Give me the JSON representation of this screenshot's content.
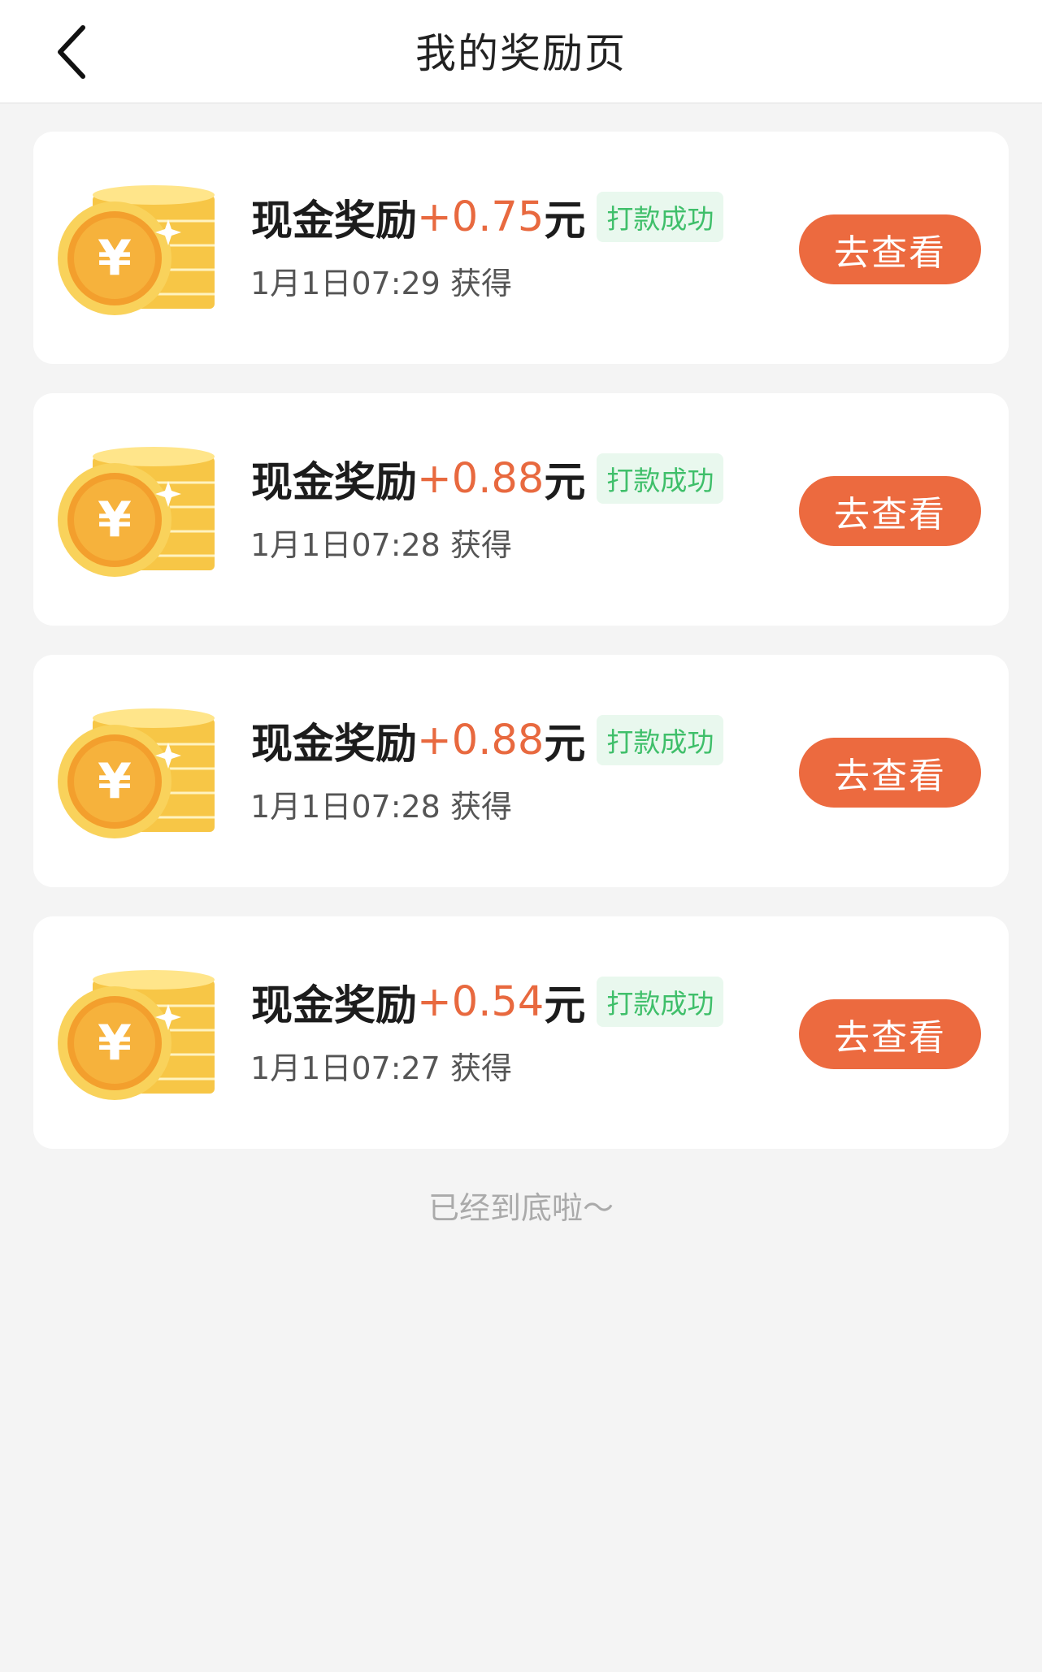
{
  "header": {
    "title": "我的奖励页",
    "back_icon": "chevron-left-icon"
  },
  "rewards": [
    {
      "label": "现金奖励",
      "amount": "+0.75",
      "unit": "元",
      "status": "打款成功",
      "time": "1月1日07:29 获得",
      "button": "去查看"
    },
    {
      "label": "现金奖励",
      "amount": "+0.88",
      "unit": "元",
      "status": "打款成功",
      "time": "1月1日07:28 获得",
      "button": "去查看"
    },
    {
      "label": "现金奖励",
      "amount": "+0.88",
      "unit": "元",
      "status": "打款成功",
      "time": "1月1日07:28 获得",
      "button": "去查看"
    },
    {
      "label": "现金奖励",
      "amount": "+0.54",
      "unit": "元",
      "status": "打款成功",
      "time": "1月1日07:27 获得",
      "button": "去查看"
    }
  ],
  "footer": {
    "end_text": "已经到底啦～"
  },
  "colors": {
    "accent": "#ec6a3f",
    "amount": "#e8693f",
    "status_text": "#3fbf6a",
    "status_bg": "#e9f8ee",
    "page_bg": "#f4f4f4"
  }
}
